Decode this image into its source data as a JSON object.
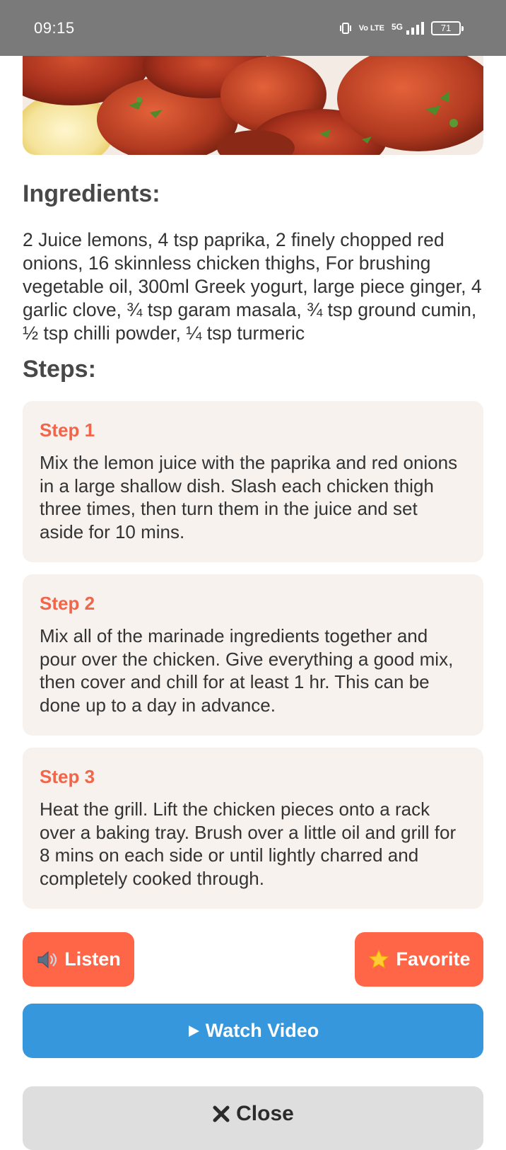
{
  "status_bar": {
    "time": "09:15",
    "volte": "Vo LTE",
    "network": "5G",
    "battery": "71"
  },
  "ingredients": {
    "heading": "Ingredients:",
    "text": "2 Juice lemons, 4 tsp paprika, 2 finely chopped red onions, 16 skinnless chicken thighs, For brushing vegetable oil, 300ml Greek yogurt, large piece ginger, 4 garlic clove, ¾ tsp garam masala, ¾ tsp ground cumin, ½ tsp chilli powder, ¼ tsp turmeric"
  },
  "steps": {
    "heading": "Steps:",
    "items": [
      {
        "title": "Step 1",
        "text": "Mix the lemon juice with the paprika and red onions in a large shallow dish. Slash each chicken thigh three times, then turn them in the juice and set aside for 10 mins."
      },
      {
        "title": "Step 2",
        "text": "Mix all of the marinade ingredients together and pour over the chicken. Give everything a good mix, then cover and chill for at least 1 hr. This can be done up to a day in advance."
      },
      {
        "title": "Step 3",
        "text": "Heat the grill. Lift the chicken pieces onto a rack over a baking tray. Brush over a little oil and grill for 8 mins on each side or until lightly charred and completely cooked through."
      }
    ]
  },
  "actions": {
    "listen_label": "Listen",
    "favorite_label": "Favorite",
    "video_label": "Watch Video",
    "close_label": "Close"
  },
  "icons": {
    "listen": "speaker-icon",
    "favorite": "star-icon",
    "video": "play-icon",
    "close": "x-icon"
  },
  "colors": {
    "accent": "#fe6647",
    "step_title": "#f1654a",
    "video_button": "#3797dc",
    "close_button": "#dedede",
    "step_card_bg": "#f7f2ee"
  }
}
